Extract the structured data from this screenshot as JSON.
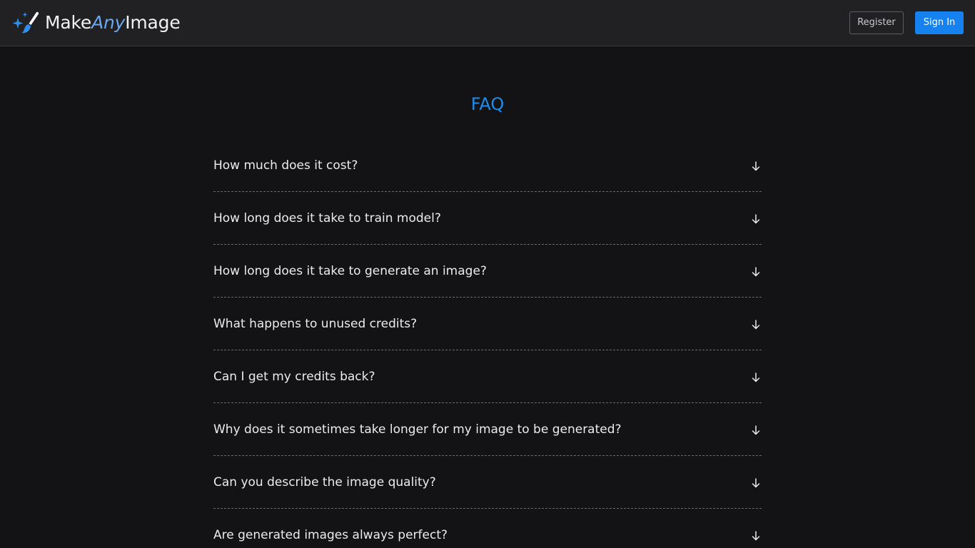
{
  "header": {
    "brand": {
      "make": "Make",
      "any": "Any",
      "image": "Image"
    },
    "register_label": "Register",
    "signin_label": "Sign In"
  },
  "faq": {
    "title": "FAQ",
    "items": [
      {
        "question": "How much does it cost?"
      },
      {
        "question": "How long does it take to train model?"
      },
      {
        "question": "How long does it take to generate an image?"
      },
      {
        "question": "What happens to unused credits?"
      },
      {
        "question": "Can I get my credits back?"
      },
      {
        "question": "Why does it sometimes take longer for my image to be generated?"
      },
      {
        "question": "Can you describe the image quality?"
      },
      {
        "question": "Are generated images always perfect?"
      }
    ]
  },
  "colors": {
    "page_bg": "#131316",
    "header_bg": "#212124",
    "accent": "#1f8cec",
    "primary_button": "#1582f0",
    "brand_any": "#69a8ef"
  },
  "icons": {
    "logo": "sparkle-brush-icon",
    "faq_toggle": "arrow-down-icon"
  }
}
